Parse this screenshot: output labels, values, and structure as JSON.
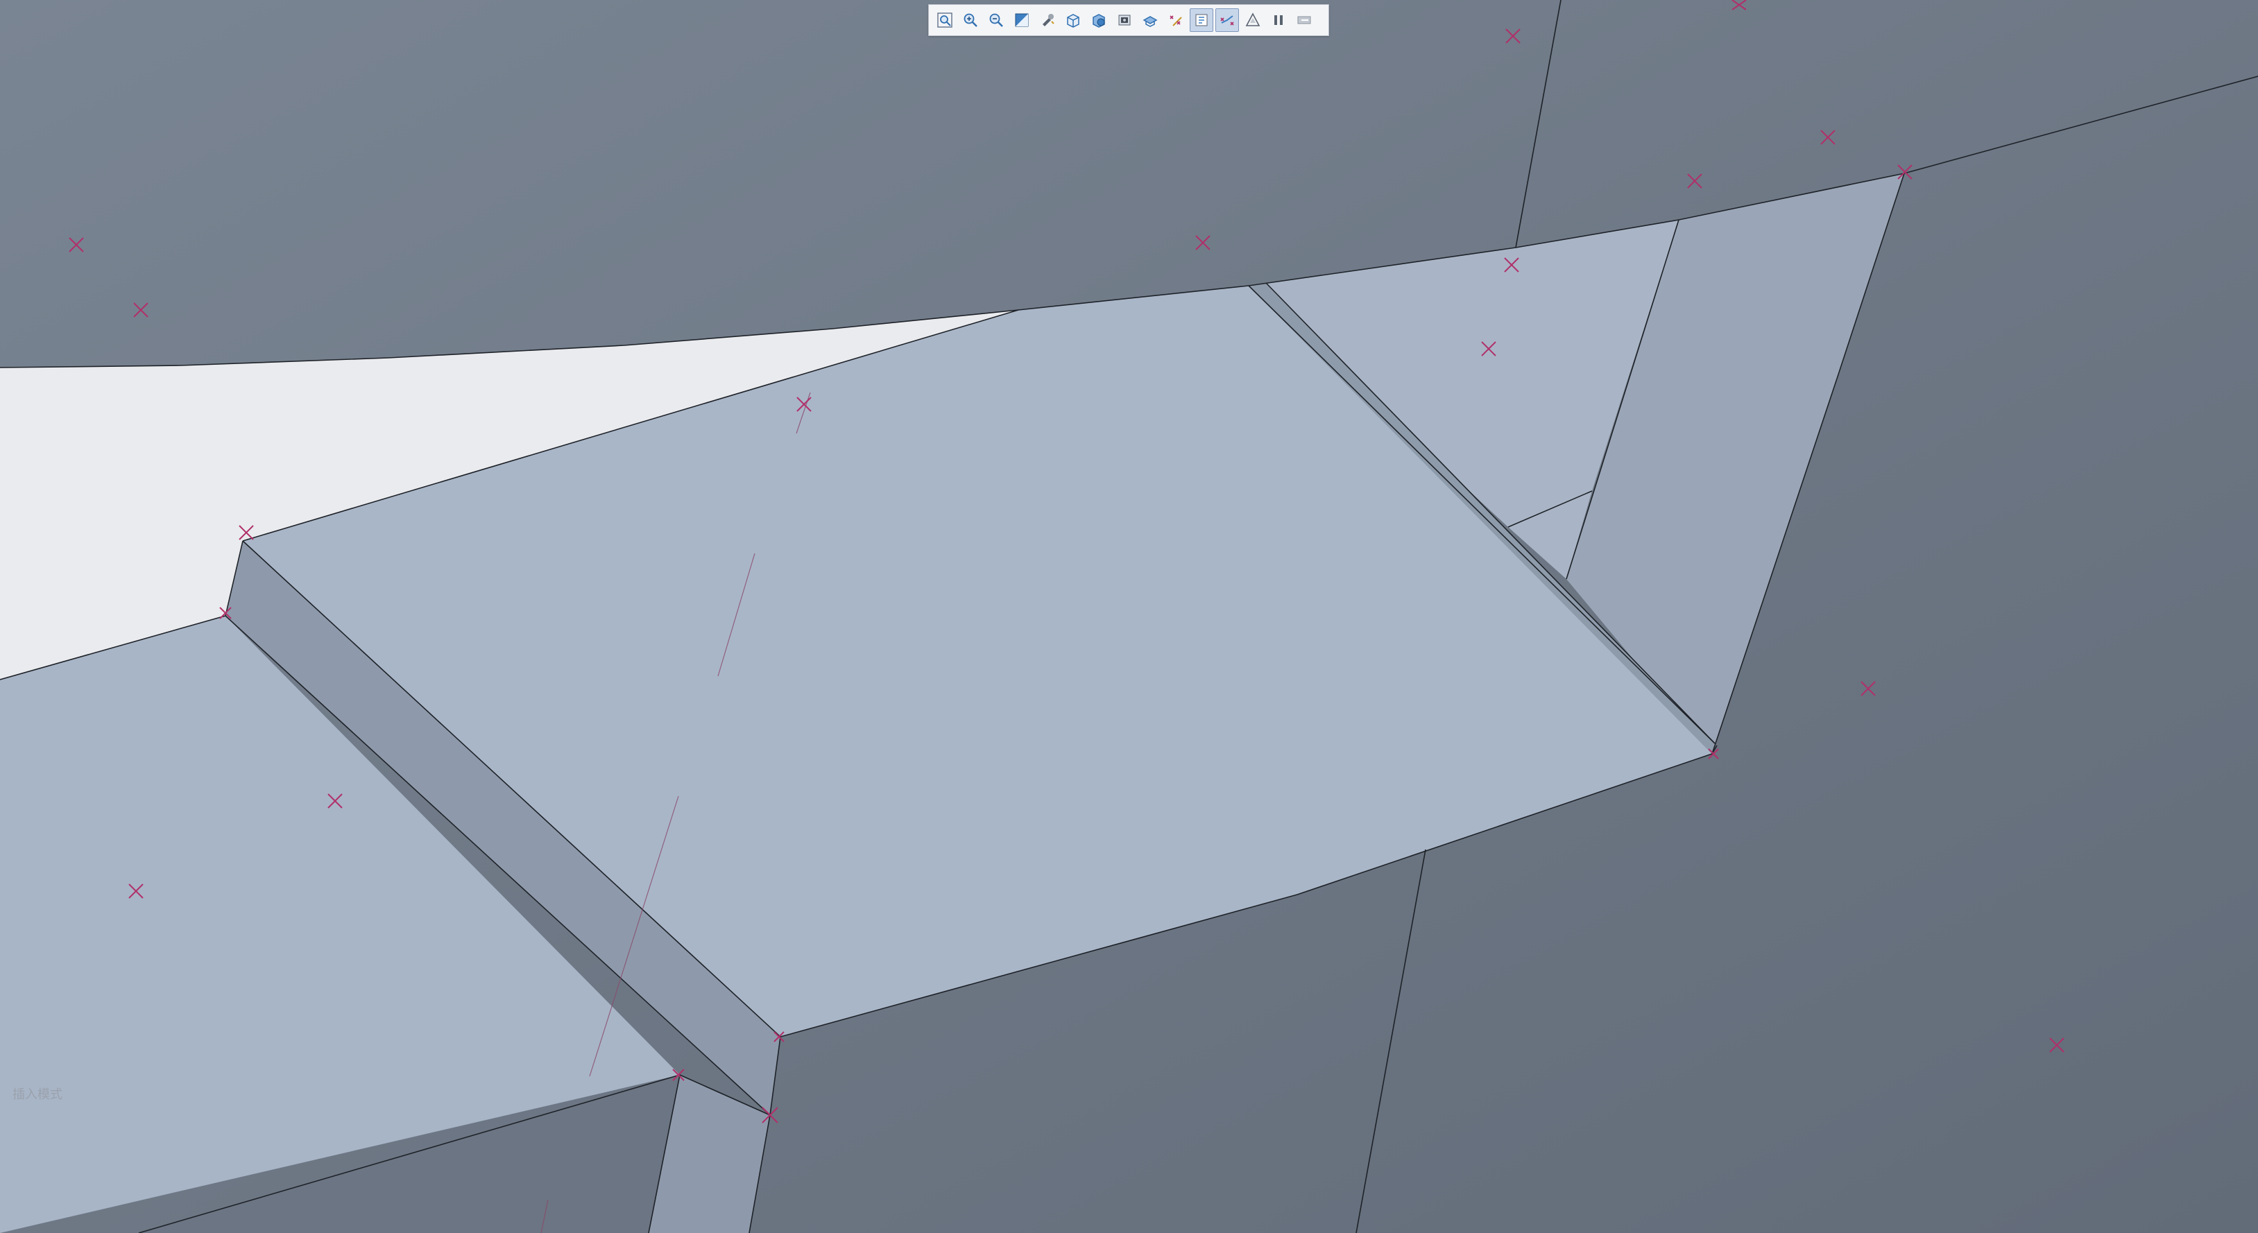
{
  "toolbar": {
    "buttons": [
      {
        "icon": "zoom-fit-icon",
        "active": false
      },
      {
        "icon": "zoom-in-icon",
        "active": false
      },
      {
        "icon": "zoom-out-icon",
        "active": false
      },
      {
        "icon": "repaint-icon",
        "active": false
      },
      {
        "icon": "spin-center-icon",
        "active": false
      },
      {
        "icon": "display-style-icon",
        "active": false
      },
      {
        "icon": "named-views-icon",
        "active": false
      },
      {
        "icon": "view-manager-icon",
        "active": false
      },
      {
        "icon": "saved-orientation-icon",
        "active": false
      },
      {
        "icon": "datum-display-icon",
        "active": false
      },
      {
        "icon": "annotation-display-icon",
        "active": true
      },
      {
        "icon": "point-display-icon",
        "active": true
      },
      {
        "icon": "csys-display-icon",
        "active": false
      },
      {
        "icon": "pause-icon",
        "active": false
      },
      {
        "icon": "appearance-icon",
        "active": false
      }
    ]
  },
  "viewport": {
    "mode_label": "插入模式"
  },
  "colors": {
    "background_dark": "#6f7886",
    "top_face": "#a9b6c8",
    "side_face": "#8d9aaa",
    "light_bg": "#eaebee",
    "point_marker": "#b0306a",
    "edge": "#1e2228"
  }
}
